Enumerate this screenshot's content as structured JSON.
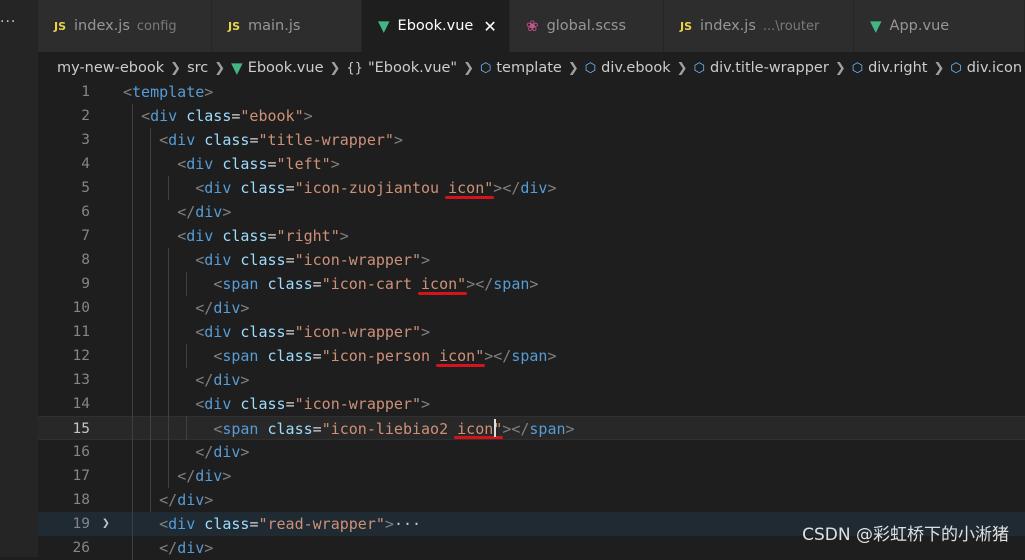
{
  "tabs": [
    {
      "icon": "js-icon",
      "label": "index.js",
      "desc": "config",
      "active": false
    },
    {
      "icon": "js-icon",
      "label": "main.js",
      "desc": "",
      "active": false
    },
    {
      "icon": "vue-icon",
      "label": "Ebook.vue",
      "desc": "",
      "active": true
    },
    {
      "icon": "scss-icon",
      "label": "global.scss",
      "desc": "",
      "active": false
    },
    {
      "icon": "js-icon",
      "label": "index.js",
      "desc": "...\\router",
      "active": false
    },
    {
      "icon": "vue-icon",
      "label": "App.vue",
      "desc": "",
      "active": false
    }
  ],
  "tab_icon_text": {
    "js": "JS"
  },
  "breadcrumb": [
    {
      "label": "my-new-ebook",
      "icon": ""
    },
    {
      "label": "src",
      "icon": ""
    },
    {
      "label": "Ebook.vue",
      "icon": "vue-icon"
    },
    {
      "label": "\"Ebook.vue\"",
      "icon": "braces-icon"
    },
    {
      "label": "template",
      "icon": "cube-icon"
    },
    {
      "label": "div.ebook",
      "icon": "cube-icon"
    },
    {
      "label": "div.title-wrapper",
      "icon": "cube-icon"
    },
    {
      "label": "div.right",
      "icon": "cube-icon"
    },
    {
      "label": "div.icon",
      "icon": "cube-icon"
    }
  ],
  "lines": [
    {
      "n": "1",
      "code": "<template>"
    },
    {
      "n": "2",
      "code": "  <div class=\"ebook\">"
    },
    {
      "n": "3",
      "code": "    <div class=\"title-wrapper\">"
    },
    {
      "n": "4",
      "code": "      <div class=\"left\">"
    },
    {
      "n": "5",
      "code": "        <div class=\"icon-zuojiantou icon\"></div>"
    },
    {
      "n": "6",
      "code": "      </div>"
    },
    {
      "n": "7",
      "code": "      <div class=\"right\">"
    },
    {
      "n": "8",
      "code": "        <div class=\"icon-wrapper\">"
    },
    {
      "n": "9",
      "code": "          <span class=\"icon-cart icon\"></span>"
    },
    {
      "n": "10",
      "code": "        </div>"
    },
    {
      "n": "11",
      "code": "        <div class=\"icon-wrapper\">"
    },
    {
      "n": "12",
      "code": "          <span class=\"icon-person icon\"></span>"
    },
    {
      "n": "13",
      "code": "        </div>"
    },
    {
      "n": "14",
      "code": "        <div class=\"icon-wrapper\">"
    },
    {
      "n": "15",
      "code": "          <span class=\"icon-liebiao2 icon\"></span>"
    },
    {
      "n": "16",
      "code": "        </div>"
    },
    {
      "n": "17",
      "code": "      </div>"
    },
    {
      "n": "18",
      "code": "    </div>"
    },
    {
      "n": "19",
      "code": "    <div class=\"read-wrapper\">···"
    },
    {
      "n": "26",
      "code": "    </div>"
    }
  ],
  "current_line": "15",
  "folded_line": "19",
  "underlined_word": "icon",
  "underline_color": "#d4141c",
  "watermark": "CSDN @彩虹桥下的小淅猪",
  "menu_more": "···"
}
